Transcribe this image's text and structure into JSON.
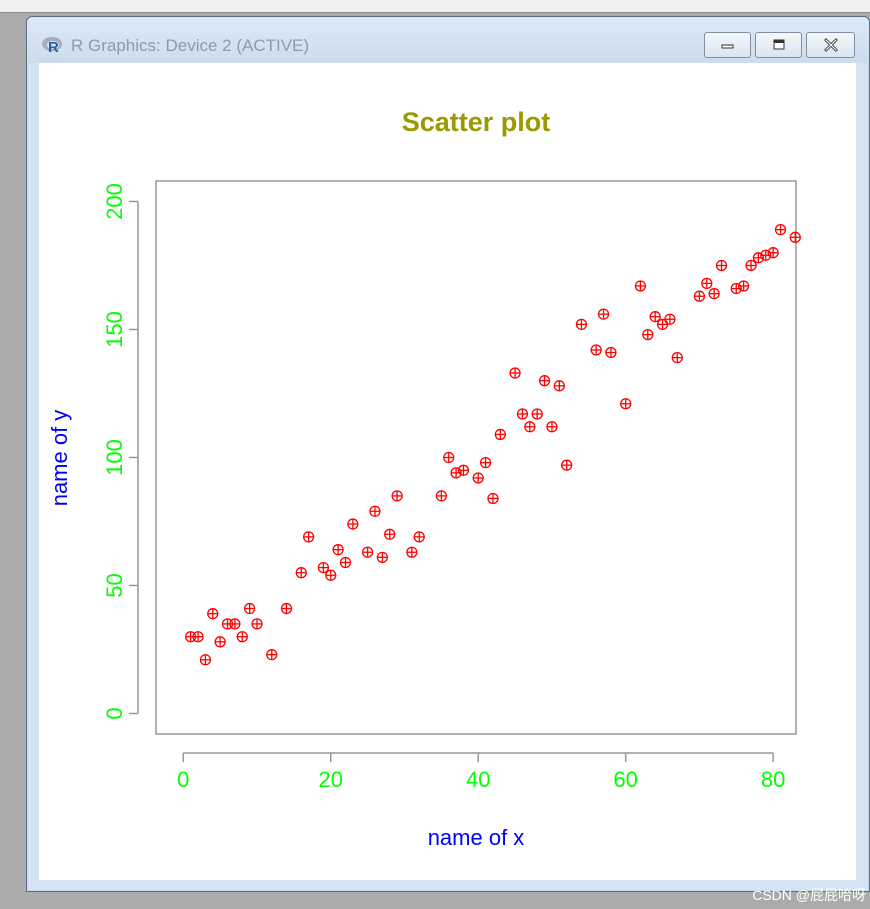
{
  "window": {
    "title": "R Graphics: Device 2 (ACTIVE)",
    "icons": {
      "app": "r-logo-icon",
      "minimize": "minimize-icon",
      "maximize": "maximize-icon",
      "close": "close-icon"
    }
  },
  "watermark": "CSDN @屁屁哈呀",
  "colors": {
    "title": "#999900",
    "axis_label": "#0000ff",
    "tick_label": "#00ff00",
    "points": "#ff0000",
    "axes": "#999999"
  },
  "chart_data": {
    "type": "scatter",
    "title": "Scatter plot",
    "xlabel": "name of x",
    "ylabel": "name of y",
    "xlim": [
      -3.7,
      83.1
    ],
    "ylim": [
      -8,
      208
    ],
    "xticks": [
      0,
      20,
      40,
      60,
      80
    ],
    "yticks": [
      0,
      50,
      100,
      150,
      200
    ],
    "x_tick_labels": [
      "0",
      "20",
      "40",
      "60",
      "80"
    ],
    "y_tick_labels": [
      "0",
      "50",
      "100",
      "150",
      "200"
    ],
    "grid": false,
    "point_symbol": "circle-plus",
    "points": [
      {
        "x": 1,
        "y": 30
      },
      {
        "x": 2,
        "y": 30
      },
      {
        "x": 3,
        "y": 21
      },
      {
        "x": 4,
        "y": 39
      },
      {
        "x": 5,
        "y": 28
      },
      {
        "x": 6,
        "y": 35
      },
      {
        "x": 7,
        "y": 35
      },
      {
        "x": 8,
        "y": 30
      },
      {
        "x": 9,
        "y": 41
      },
      {
        "x": 10,
        "y": 35
      },
      {
        "x": 12,
        "y": 23
      },
      {
        "x": 14,
        "y": 41
      },
      {
        "x": 16,
        "y": 55
      },
      {
        "x": 17,
        "y": 69
      },
      {
        "x": 19,
        "y": 57
      },
      {
        "x": 20,
        "y": 54
      },
      {
        "x": 21,
        "y": 64
      },
      {
        "x": 22,
        "y": 59
      },
      {
        "x": 23,
        "y": 74
      },
      {
        "x": 25,
        "y": 63
      },
      {
        "x": 26,
        "y": 79
      },
      {
        "x": 27,
        "y": 61
      },
      {
        "x": 28,
        "y": 70
      },
      {
        "x": 29,
        "y": 85
      },
      {
        "x": 31,
        "y": 63
      },
      {
        "x": 32,
        "y": 69
      },
      {
        "x": 35,
        "y": 85
      },
      {
        "x": 36,
        "y": 100
      },
      {
        "x": 37,
        "y": 94
      },
      {
        "x": 38,
        "y": 95
      },
      {
        "x": 40,
        "y": 92
      },
      {
        "x": 41,
        "y": 98
      },
      {
        "x": 42,
        "y": 84
      },
      {
        "x": 43,
        "y": 109
      },
      {
        "x": 45,
        "y": 133
      },
      {
        "x": 46,
        "y": 117
      },
      {
        "x": 47,
        "y": 112
      },
      {
        "x": 48,
        "y": 117
      },
      {
        "x": 49,
        "y": 130
      },
      {
        "x": 50,
        "y": 112
      },
      {
        "x": 51,
        "y": 128
      },
      {
        "x": 52,
        "y": 97
      },
      {
        "x": 54,
        "y": 152
      },
      {
        "x": 56,
        "y": 142
      },
      {
        "x": 57,
        "y": 156
      },
      {
        "x": 58,
        "y": 141
      },
      {
        "x": 60,
        "y": 121
      },
      {
        "x": 62,
        "y": 167
      },
      {
        "x": 63,
        "y": 148
      },
      {
        "x": 64,
        "y": 155
      },
      {
        "x": 65,
        "y": 152
      },
      {
        "x": 66,
        "y": 154
      },
      {
        "x": 67,
        "y": 139
      },
      {
        "x": 70,
        "y": 163
      },
      {
        "x": 71,
        "y": 168
      },
      {
        "x": 72,
        "y": 164
      },
      {
        "x": 73,
        "y": 175
      },
      {
        "x": 75,
        "y": 166
      },
      {
        "x": 76,
        "y": 167
      },
      {
        "x": 77,
        "y": 175
      },
      {
        "x": 78,
        "y": 178
      },
      {
        "x": 79,
        "y": 179
      },
      {
        "x": 80,
        "y": 180
      },
      {
        "x": 81,
        "y": 189
      },
      {
        "x": 83,
        "y": 186
      }
    ]
  }
}
